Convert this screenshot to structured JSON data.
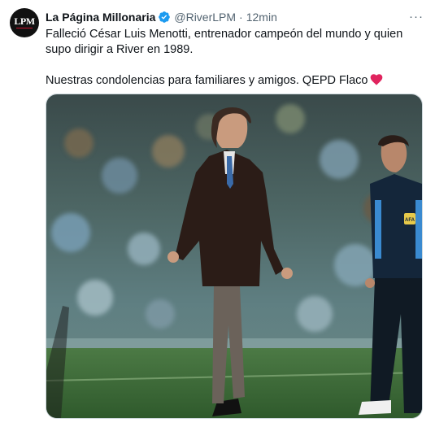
{
  "tweet": {
    "avatar_text": "LPM",
    "display_name": "La Página Millonaria",
    "handle": "@RiverLPM",
    "separator": "·",
    "time": "12min",
    "more_label": "···",
    "text_line1": "Falleció César Luis Menotti, entrenador campeón del mundo y quien supo dirigir a River en 1989.",
    "text_line2": "Nuestras condolencias para familiares y amigos. QEPD Flaco",
    "badge_text": "AFA",
    "colors": {
      "verified": "#1d9bf0",
      "heart": "#e0245e",
      "secondary_text": "#536471",
      "primary_text": "#0f1419"
    },
    "icons": [
      "verified-badge-icon",
      "more-icon",
      "red-heart-emoji-icon"
    ]
  }
}
